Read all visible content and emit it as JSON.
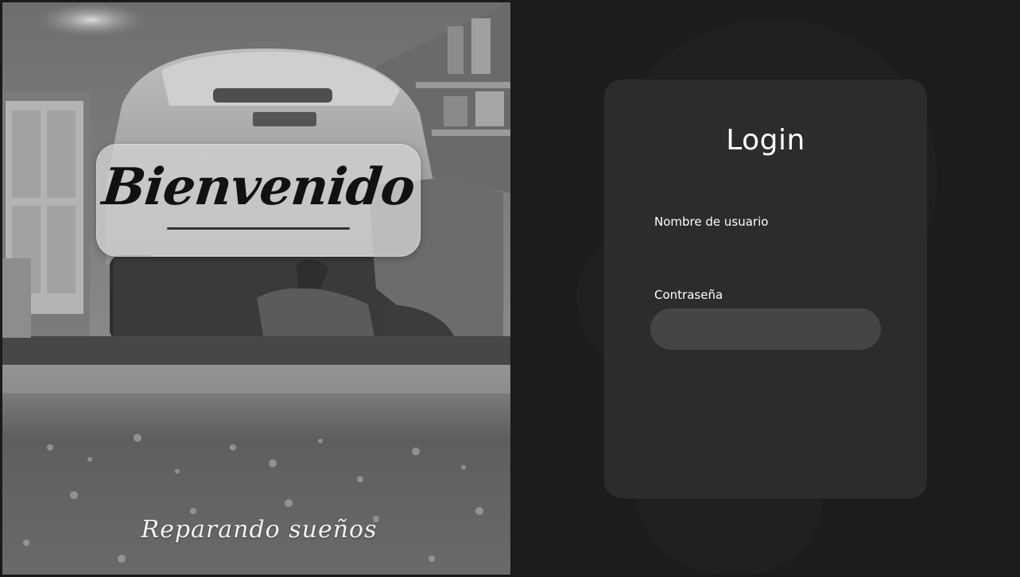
{
  "welcome": {
    "title": "Bienvenido",
    "tagline": "Reparando sueños"
  },
  "login": {
    "title": "Login",
    "username_label": "Nombre de usuario",
    "username_value": "",
    "password_label": "Contraseña",
    "password_value": ""
  },
  "icons": {
    "background_photo": "garage-mechanic-photo",
    "background_mark": "watermark-logo"
  },
  "colors": {
    "page_background": "#1c1c1c",
    "card_background": "#303030",
    "input_background": "#454545",
    "text_primary": "#ffffff",
    "welcome_text": "#111111"
  }
}
